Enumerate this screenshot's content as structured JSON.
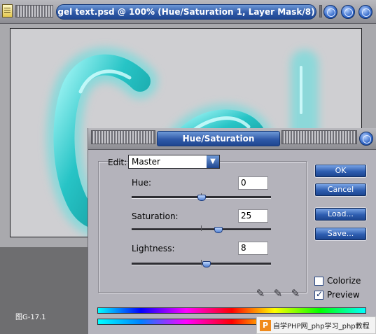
{
  "document": {
    "title": "gel text.psd @ 100% (Hue/Saturation 1, Layer Mask/8)",
    "canvas_text": "Gel",
    "gel_color": "#2ec8c8",
    "caption": "图G-17.1"
  },
  "dialog": {
    "title": "Hue/Saturation",
    "edit_label": "Edit:",
    "edit_value": "Master",
    "hue": {
      "label": "Hue:",
      "value": "0",
      "slider_fraction": 0.5
    },
    "saturation": {
      "label": "Saturation:",
      "value": "25",
      "slider_fraction": 0.625
    },
    "lightness": {
      "label": "Lightness:",
      "value": "8",
      "slider_fraction": 0.54
    },
    "buttons": {
      "ok": "OK",
      "cancel": "Cancel",
      "load": "Load...",
      "save": "Save..."
    },
    "colorize": {
      "label": "Colorize",
      "checked": false
    },
    "preview": {
      "label": "Preview",
      "checked": true
    },
    "eyedroppers": [
      "eyedropper-icon",
      "eyedropper-plus-icon",
      "eyedropper-minus-icon"
    ]
  },
  "watermark": {
    "text": "自学PHP网_php学习_php教程",
    "logo": "P"
  },
  "colors": {
    "title_blue": "#2f59a8",
    "dialog_bg": "#b4b3bb",
    "doc_bg": "#a9a9ad"
  }
}
